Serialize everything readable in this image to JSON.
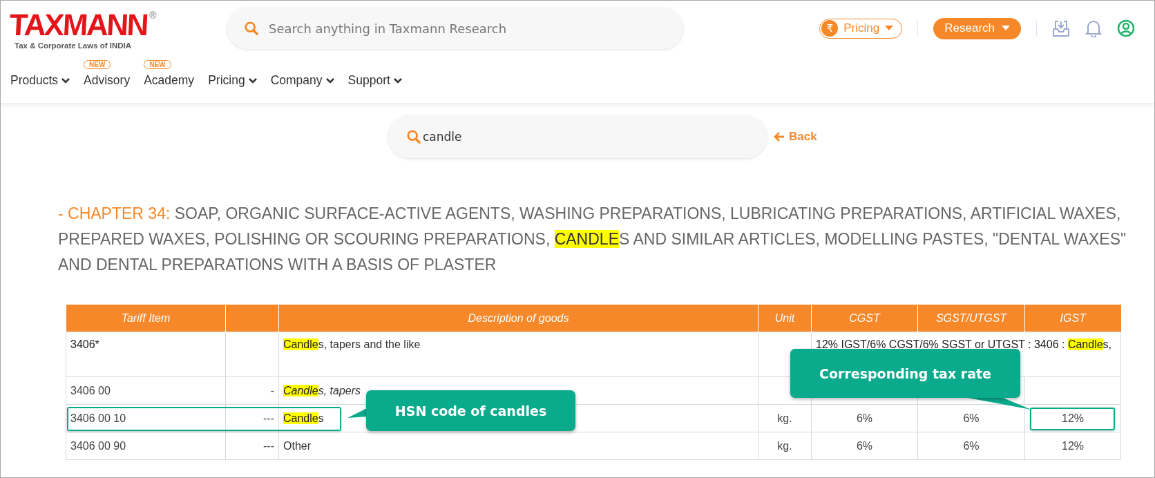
{
  "logo": {
    "name": "TAXMANN",
    "registered": "®",
    "tagline": "Tax & Corporate Laws of INDIA"
  },
  "top_search": {
    "placeholder": "Search anything in Taxmann Research"
  },
  "header_actions": {
    "pricing": {
      "symbol": "₹",
      "label": "Pricing"
    },
    "research": {
      "label": "Research"
    }
  },
  "nav": [
    {
      "label": "Products",
      "dropdown": true
    },
    {
      "label": "Advisory",
      "dropdown": false,
      "badge": "NEW"
    },
    {
      "label": "Academy",
      "dropdown": false,
      "badge": "NEW"
    },
    {
      "label": "Pricing",
      "dropdown": true
    },
    {
      "label": "Company",
      "dropdown": true
    },
    {
      "label": "Support",
      "dropdown": true
    }
  ],
  "search": {
    "value": "candle"
  },
  "back_link": {
    "label": "Back"
  },
  "chapter_heading": [
    {
      "text": "- CHAPTER 34: ",
      "kind": "label"
    },
    {
      "text": "SOAP, ORGANIC SURFACE-ACTIVE AGENTS, WASHING PREPARATIONS, LUBRICATING PREPARATIONS, ARTIFICIAL WAXES, PREPARED WAXES, POLISHING OR SCOURING PREPARATIONS, ",
      "kind": "text"
    },
    {
      "text": "CANDLE",
      "kind": "match"
    },
    {
      "text": "S AND SIMILAR ARTICLES, MODELLING PASTES, \"DENTAL WAXES\" AND DENTAL PREPARATIONS WITH A BASIS OF PLASTER",
      "kind": "text"
    }
  ],
  "table": {
    "columns": [
      {
        "label": "Tariff Item"
      },
      {},
      {
        "label": "Description of goods"
      },
      {
        "label": "Unit"
      },
      {
        "label": "CGST"
      },
      {
        "label": "SGST/UTGST"
      },
      {
        "label": "IGST"
      }
    ],
    "rows": [
      {
        "kind": "heading",
        "tariff": "3406*",
        "description": [
          {
            "text": "Candle",
            "highlight": true
          },
          {
            "text": "s, tapers and the like",
            "highlight": false
          }
        ],
        "note": [
          {
            "text": "12% IGST/6% CGST/6% SGST or UTGST : 3406 : ",
            "highlight": false
          },
          {
            "text": "Candle",
            "highlight": true
          },
          {
            "text": "s,",
            "highlight": false
          }
        ],
        "highlighted": false
      },
      {
        "kind": "subheading",
        "tariff": "3406 00",
        "dash": "-",
        "description": [
          {
            "text": "Candle",
            "highlight": true
          },
          {
            "text": "s, tapers",
            "highlight": false
          }
        ],
        "highlighted": false
      },
      {
        "kind": "item",
        "tariff": "3406 00 10",
        "dash": "---",
        "description": [
          {
            "text": "Candle",
            "highlight": true
          },
          {
            "text": "s",
            "highlight": false
          }
        ],
        "unit": "kg.",
        "cgst": "6%",
        "sgst": "6%",
        "igst": "12%",
        "highlighted": true
      },
      {
        "kind": "item",
        "tariff": "3406 00 90",
        "dash": "---",
        "description": [
          {
            "text": "Other",
            "highlight": false
          }
        ],
        "unit": "kg.",
        "cgst": "6%",
        "sgst": "6%",
        "igst": "12%",
        "highlighted": false
      }
    ]
  },
  "callouts": [
    {
      "text": "HSN code of candles"
    },
    {
      "text": "Corresponding tax rate"
    }
  ]
}
